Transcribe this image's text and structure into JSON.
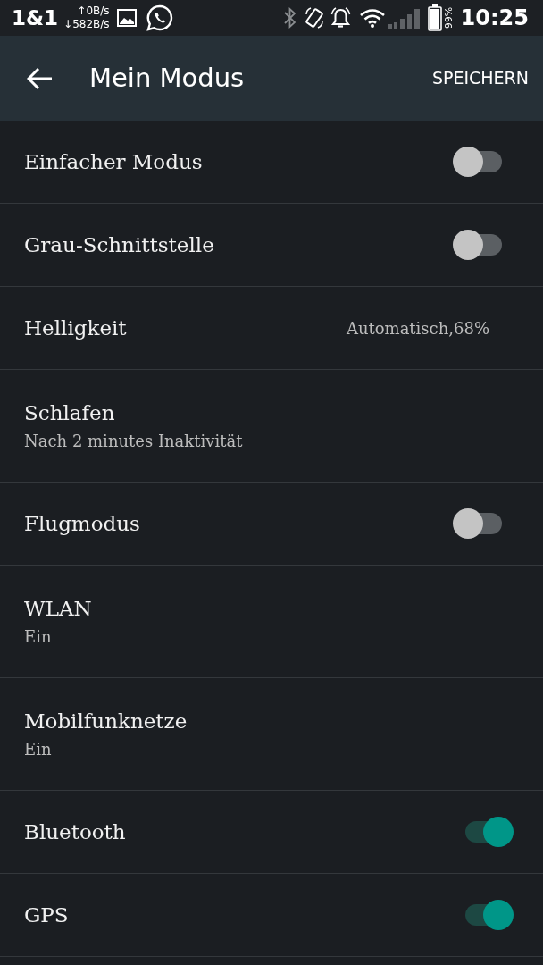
{
  "status_bar": {
    "carrier": "1&1",
    "upload": "↑0B/s",
    "download": "↓582B/s",
    "battery": "99%",
    "time": "10:25"
  },
  "app_bar": {
    "title": "Mein Modus",
    "action": "SPEICHERN"
  },
  "settings": [
    {
      "kind": "toggle",
      "label": "Einfacher Modus",
      "on": false
    },
    {
      "kind": "toggle",
      "label": "Grau-Schnittstelle",
      "on": false
    },
    {
      "kind": "value",
      "label": "Helligkeit",
      "value": "Automatisch,68%"
    },
    {
      "kind": "detail",
      "label": "Schlafen",
      "summary": "Nach 2 minutes Inaktivität"
    },
    {
      "kind": "toggle",
      "label": "Flugmodus",
      "on": false
    },
    {
      "kind": "detail",
      "label": "WLAN",
      "summary": "Ein"
    },
    {
      "kind": "detail",
      "label": "Mobilfunknetze",
      "summary": "Ein"
    },
    {
      "kind": "toggle",
      "label": "Bluetooth",
      "on": true
    },
    {
      "kind": "toggle",
      "label": "GPS",
      "on": true
    }
  ]
}
